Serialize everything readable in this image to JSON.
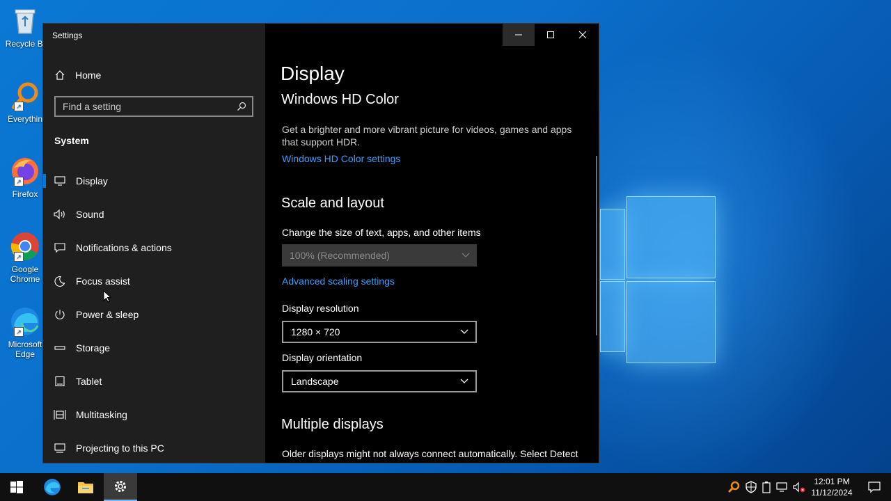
{
  "desktop": {
    "icons": [
      {
        "label": "Recycle Bi",
        "icon": "recycle-bin-icon"
      },
      {
        "label": "Everythin",
        "icon": "everything-search-icon"
      },
      {
        "label": "Firefox",
        "icon": "firefox-icon"
      },
      {
        "label": "Google Chrome",
        "icon": "chrome-icon"
      },
      {
        "label": "Microsoft Edge",
        "icon": "edge-icon"
      }
    ]
  },
  "window": {
    "title": "Settings",
    "controls": [
      "minimize-icon",
      "maximize-icon",
      "close-icon"
    ]
  },
  "sidebar": {
    "home_label": "Home",
    "search_placeholder": "Find a setting",
    "section_label": "System",
    "items": [
      {
        "label": "Display",
        "icon": "monitor-icon",
        "active": true
      },
      {
        "label": "Sound",
        "icon": "speaker-icon"
      },
      {
        "label": "Notifications & actions",
        "icon": "notification-icon"
      },
      {
        "label": "Focus assist",
        "icon": "moon-icon"
      },
      {
        "label": "Power & sleep",
        "icon": "power-icon"
      },
      {
        "label": "Storage",
        "icon": "storage-icon"
      },
      {
        "label": "Tablet",
        "icon": "tablet-icon"
      },
      {
        "label": "Multitasking",
        "icon": "multitasking-icon"
      },
      {
        "label": "Projecting to this PC",
        "icon": "projecting-icon"
      }
    ]
  },
  "content": {
    "page_title": "Display",
    "hdr": {
      "heading": "Windows HD Color",
      "description": "Get a brighter and more vibrant picture for videos, games and apps that support HDR.",
      "link": "Windows HD Color settings"
    },
    "scale": {
      "heading": "Scale and layout",
      "size_label": "Change the size of text, apps, and other items",
      "size_value": "100% (Recommended)",
      "advanced_link": "Advanced scaling settings",
      "resolution_label": "Display resolution",
      "resolution_value": "1280 × 720",
      "orientation_label": "Display orientation",
      "orientation_value": "Landscape"
    },
    "multiple": {
      "heading": "Multiple displays",
      "description": "Older displays might not always connect automatically. Select Detect"
    }
  },
  "taskbar": {
    "apps": [
      "start-icon",
      "edge-icon",
      "file-explorer-icon",
      "settings-icon"
    ],
    "tray_icons": [
      "everything-tray-icon",
      "security-icon",
      "battery-icon",
      "network-icon",
      "volume-muted-icon"
    ],
    "time": "12:01 PM",
    "date": "11/12/2024",
    "notification_icon": "action-center-icon"
  },
  "colors": {
    "accent": "#0078d7",
    "link": "#3aa0ff",
    "sidebar_bg": "#1f1f1f",
    "content_bg": "#000000"
  }
}
